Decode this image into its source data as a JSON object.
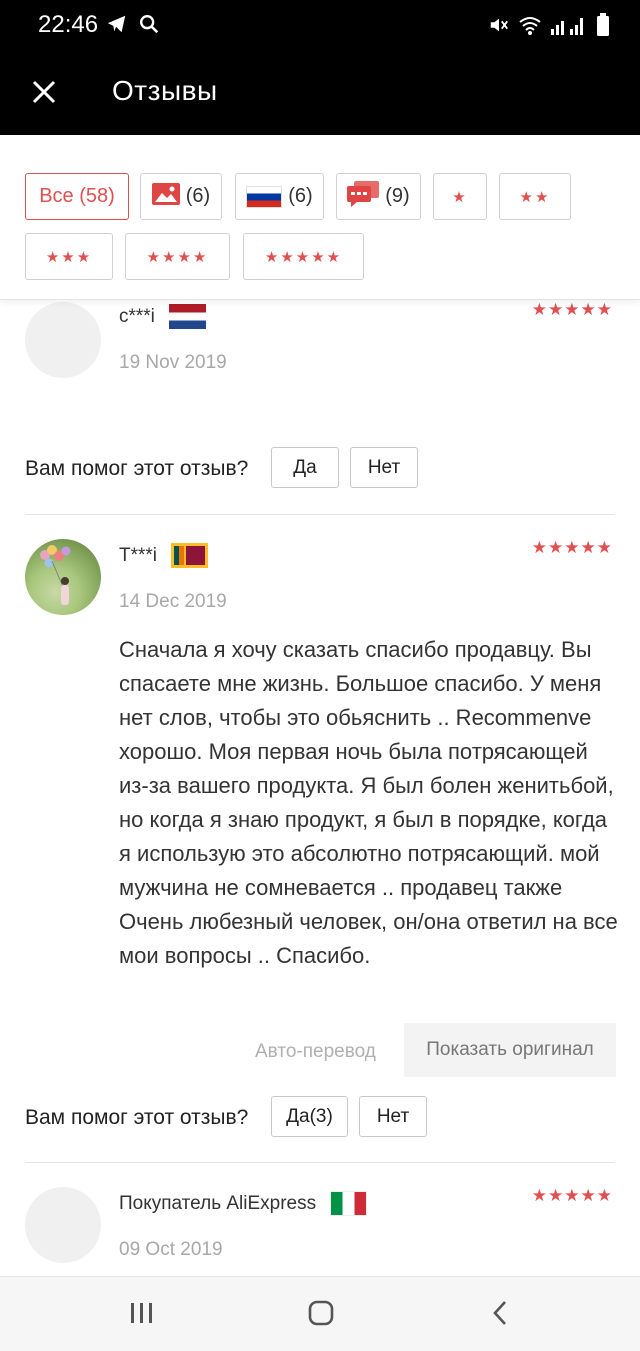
{
  "status_bar": {
    "time": "22:46"
  },
  "header": {
    "title": "Отзывы"
  },
  "filters": {
    "all": "Все (58)",
    "photos_count": "(6)",
    "russia_count": "(6)",
    "comments_count": "(9)",
    "star1": "★",
    "star2": "★★",
    "star3": "★★★",
    "star4": "★★★★",
    "star5": "★★★★★"
  },
  "reviews": [
    {
      "name": "c***i",
      "flag": "netherlands",
      "date": "19 Nov 2019",
      "stars": "★★★★★",
      "helpful_label": "Вам помог этот отзыв?",
      "yes": "Да",
      "no": "Нет"
    },
    {
      "name": "T***i",
      "flag": "sri-lanka",
      "date": "14 Dec 2019",
      "stars": "★★★★★",
      "text": "Сначала я хочу сказать спасибо продавцу. Вы спасаете мне жизнь. Большое спасибо. У меня нет слов, чтобы это обьяснить .. Recommenve хорошо. Моя первая ночь была потрясающей из-за вашего продукта. Я был болен женитьбой, но когда я знаю продукт, я был в порядке, когда я использую это абсолютно потрясающий. мой мужчина не сомневается .. продавец также Очень любезный человек, он/она ответил на все мои вопросы .. Спасибо.",
      "auto_translate": "Авто-перевод",
      "show_original": "Показать оригинал",
      "helpful_label": "Вам помог этот отзыв?",
      "yes": "Да(3)",
      "no": "Нет"
    },
    {
      "name": "Покупатель AliExpress",
      "flag": "italy",
      "date": "09 Oct 2019",
      "stars": "★★★★★"
    }
  ],
  "colors": {
    "accent": "#e15050",
    "header_bg": "#000000"
  },
  "icons": [
    "telegram-icon",
    "search-icon",
    "mute-icon",
    "wifi-icon",
    "signal-icon",
    "battery-icon",
    "close-icon",
    "photo-icon",
    "comment-icon",
    "recent-apps-icon",
    "home-icon",
    "back-icon"
  ]
}
